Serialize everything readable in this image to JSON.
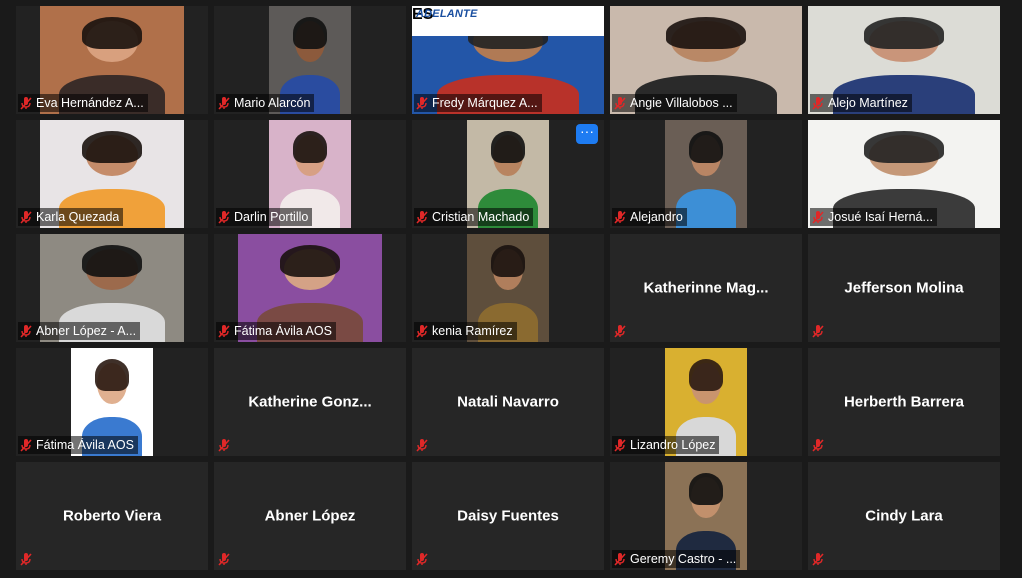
{
  "app": "Zoom gallery view",
  "colors": {
    "background": "#1a1a1a",
    "tile": "#262626",
    "muted_icon": "#e02828",
    "accent_button": "#1e7cf2"
  },
  "participants": [
    {
      "label": "Eva Hernández A...",
      "video": true,
      "muted": true
    },
    {
      "label": "Mario Alarcón",
      "video": true,
      "muted": true
    },
    {
      "label": "Fredy Márquez A...",
      "video": true,
      "muted": true,
      "banner": "ADELANTE",
      "banner_badge": "ES"
    },
    {
      "label": "Angie Villalobos ...",
      "video": true,
      "muted": true
    },
    {
      "label": "Alejo Martínez",
      "video": true,
      "muted": true
    },
    {
      "label": "Karla Quezada",
      "video": true,
      "muted": true
    },
    {
      "label": "Darlin Portillo",
      "video": true,
      "muted": true
    },
    {
      "label": "Cristian Machado",
      "video": true,
      "muted": true,
      "more_button": "···"
    },
    {
      "label": "Alejandro",
      "video": true,
      "muted": true
    },
    {
      "label": "Josué Isaí Herná...",
      "video": true,
      "muted": true
    },
    {
      "label": "Abner López - A...",
      "video": true,
      "muted": true
    },
    {
      "label": "Fátima Ávila AOS",
      "video": true,
      "muted": true
    },
    {
      "label": "kenia Ramírez",
      "video": true,
      "muted": true
    },
    {
      "label": "Katherinne  Mag...",
      "video": false,
      "muted": true
    },
    {
      "label": "Jefferson Molina",
      "video": false,
      "muted": true
    },
    {
      "label": "Fátima Ávila AOS",
      "video": true,
      "muted": true
    },
    {
      "label": "Katherine  Gonz...",
      "video": false,
      "muted": true
    },
    {
      "label": "Natali Navarro",
      "video": false,
      "muted": true
    },
    {
      "label": "Lizandro López",
      "video": true,
      "muted": true
    },
    {
      "label": "Herberth Barrera",
      "video": false,
      "muted": true
    },
    {
      "label": "Roberto Viera",
      "video": false,
      "muted": true
    },
    {
      "label": "Abner López",
      "video": false,
      "muted": true
    },
    {
      "label": "Daisy Fuentes",
      "video": false,
      "muted": true
    },
    {
      "label": "Geremy Castro - ...",
      "video": true,
      "muted": true
    },
    {
      "label": "Cindy Lara",
      "video": false,
      "muted": true
    }
  ]
}
